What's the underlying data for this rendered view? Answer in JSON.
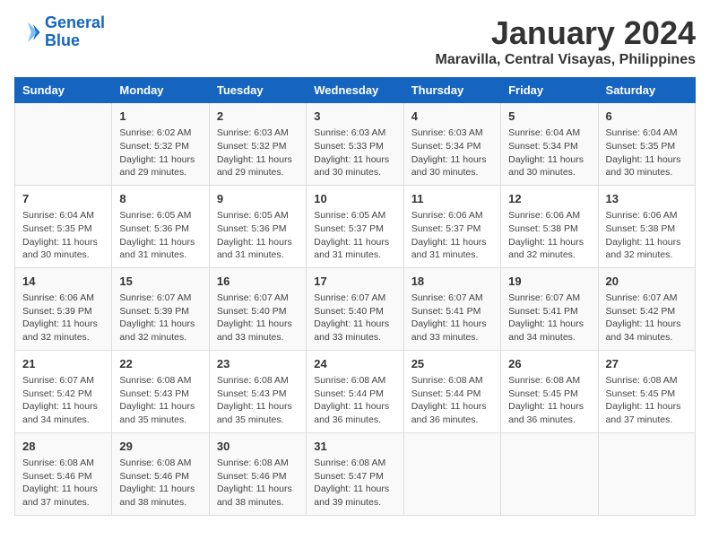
{
  "logo": {
    "line1": "General",
    "line2": "Blue"
  },
  "title": "January 2024",
  "subtitle": "Maravilla, Central Visayas, Philippines",
  "days_of_week": [
    "Sunday",
    "Monday",
    "Tuesday",
    "Wednesday",
    "Thursday",
    "Friday",
    "Saturday"
  ],
  "weeks": [
    [
      {
        "day": "",
        "info": ""
      },
      {
        "day": "1",
        "info": "Sunrise: 6:02 AM\nSunset: 5:32 PM\nDaylight: 11 hours\nand 29 minutes."
      },
      {
        "day": "2",
        "info": "Sunrise: 6:03 AM\nSunset: 5:32 PM\nDaylight: 11 hours\nand 29 minutes."
      },
      {
        "day": "3",
        "info": "Sunrise: 6:03 AM\nSunset: 5:33 PM\nDaylight: 11 hours\nand 30 minutes."
      },
      {
        "day": "4",
        "info": "Sunrise: 6:03 AM\nSunset: 5:34 PM\nDaylight: 11 hours\nand 30 minutes."
      },
      {
        "day": "5",
        "info": "Sunrise: 6:04 AM\nSunset: 5:34 PM\nDaylight: 11 hours\nand 30 minutes."
      },
      {
        "day": "6",
        "info": "Sunrise: 6:04 AM\nSunset: 5:35 PM\nDaylight: 11 hours\nand 30 minutes."
      }
    ],
    [
      {
        "day": "7",
        "info": "Sunrise: 6:04 AM\nSunset: 5:35 PM\nDaylight: 11 hours\nand 30 minutes."
      },
      {
        "day": "8",
        "info": "Sunrise: 6:05 AM\nSunset: 5:36 PM\nDaylight: 11 hours\nand 31 minutes."
      },
      {
        "day": "9",
        "info": "Sunrise: 6:05 AM\nSunset: 5:36 PM\nDaylight: 11 hours\nand 31 minutes."
      },
      {
        "day": "10",
        "info": "Sunrise: 6:05 AM\nSunset: 5:37 PM\nDaylight: 11 hours\nand 31 minutes."
      },
      {
        "day": "11",
        "info": "Sunrise: 6:06 AM\nSunset: 5:37 PM\nDaylight: 11 hours\nand 31 minutes."
      },
      {
        "day": "12",
        "info": "Sunrise: 6:06 AM\nSunset: 5:38 PM\nDaylight: 11 hours\nand 32 minutes."
      },
      {
        "day": "13",
        "info": "Sunrise: 6:06 AM\nSunset: 5:38 PM\nDaylight: 11 hours\nand 32 minutes."
      }
    ],
    [
      {
        "day": "14",
        "info": "Sunrise: 6:06 AM\nSunset: 5:39 PM\nDaylight: 11 hours\nand 32 minutes."
      },
      {
        "day": "15",
        "info": "Sunrise: 6:07 AM\nSunset: 5:39 PM\nDaylight: 11 hours\nand 32 minutes."
      },
      {
        "day": "16",
        "info": "Sunrise: 6:07 AM\nSunset: 5:40 PM\nDaylight: 11 hours\nand 33 minutes."
      },
      {
        "day": "17",
        "info": "Sunrise: 6:07 AM\nSunset: 5:40 PM\nDaylight: 11 hours\nand 33 minutes."
      },
      {
        "day": "18",
        "info": "Sunrise: 6:07 AM\nSunset: 5:41 PM\nDaylight: 11 hours\nand 33 minutes."
      },
      {
        "day": "19",
        "info": "Sunrise: 6:07 AM\nSunset: 5:41 PM\nDaylight: 11 hours\nand 34 minutes."
      },
      {
        "day": "20",
        "info": "Sunrise: 6:07 AM\nSunset: 5:42 PM\nDaylight: 11 hours\nand 34 minutes."
      }
    ],
    [
      {
        "day": "21",
        "info": "Sunrise: 6:07 AM\nSunset: 5:42 PM\nDaylight: 11 hours\nand 34 minutes."
      },
      {
        "day": "22",
        "info": "Sunrise: 6:08 AM\nSunset: 5:43 PM\nDaylight: 11 hours\nand 35 minutes."
      },
      {
        "day": "23",
        "info": "Sunrise: 6:08 AM\nSunset: 5:43 PM\nDaylight: 11 hours\nand 35 minutes."
      },
      {
        "day": "24",
        "info": "Sunrise: 6:08 AM\nSunset: 5:44 PM\nDaylight: 11 hours\nand 36 minutes."
      },
      {
        "day": "25",
        "info": "Sunrise: 6:08 AM\nSunset: 5:44 PM\nDaylight: 11 hours\nand 36 minutes."
      },
      {
        "day": "26",
        "info": "Sunrise: 6:08 AM\nSunset: 5:45 PM\nDaylight: 11 hours\nand 36 minutes."
      },
      {
        "day": "27",
        "info": "Sunrise: 6:08 AM\nSunset: 5:45 PM\nDaylight: 11 hours\nand 37 minutes."
      }
    ],
    [
      {
        "day": "28",
        "info": "Sunrise: 6:08 AM\nSunset: 5:46 PM\nDaylight: 11 hours\nand 37 minutes."
      },
      {
        "day": "29",
        "info": "Sunrise: 6:08 AM\nSunset: 5:46 PM\nDaylight: 11 hours\nand 38 minutes."
      },
      {
        "day": "30",
        "info": "Sunrise: 6:08 AM\nSunset: 5:46 PM\nDaylight: 11 hours\nand 38 minutes."
      },
      {
        "day": "31",
        "info": "Sunrise: 6:08 AM\nSunset: 5:47 PM\nDaylight: 11 hours\nand 39 minutes."
      },
      {
        "day": "",
        "info": ""
      },
      {
        "day": "",
        "info": ""
      },
      {
        "day": "",
        "info": ""
      }
    ]
  ]
}
